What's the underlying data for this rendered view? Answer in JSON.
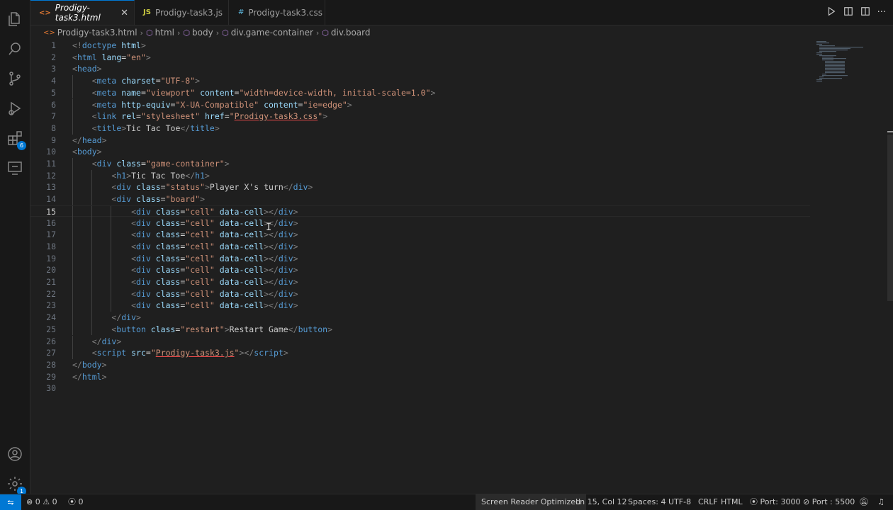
{
  "tabs": [
    {
      "label": "Prodigy-task3.html",
      "icon": "<>",
      "active": true
    },
    {
      "label": "Prodigy-task3.js",
      "icon": "JS",
      "active": false
    },
    {
      "label": "Prodigy-task3.css",
      "icon": "#",
      "active": false
    }
  ],
  "tab_close": "✕",
  "breadcrumb": [
    "Prodigy-task3.html",
    "html",
    "body",
    "div.game-container",
    "div.board"
  ],
  "activity_icons": [
    "files-icon",
    "search-icon",
    "source-control-icon",
    "run-debug-icon",
    "extensions-icon",
    "remote-explorer-icon",
    "account-icon",
    "manage-gear-icon"
  ],
  "badges": {
    "extensions": "6",
    "manage": "1"
  },
  "code_lines": [
    [
      [
        "t",
        "<!"
      ],
      [
        "k",
        "doctype "
      ],
      [
        "a",
        "html"
      ],
      [
        "t",
        ">"
      ]
    ],
    [
      [
        "t",
        "<"
      ],
      [
        "k",
        "html"
      ],
      [
        "a",
        " lang"
      ],
      [
        "p",
        "="
      ],
      [
        "s",
        "\"en\""
      ],
      [
        "t",
        ">"
      ]
    ],
    [
      [
        "t",
        "<"
      ],
      [
        "k",
        "head"
      ],
      [
        "t",
        ">"
      ]
    ],
    [
      [
        "i",
        "    "
      ],
      [
        "t",
        "<"
      ],
      [
        "k",
        "meta"
      ],
      [
        "a",
        " charset"
      ],
      [
        "p",
        "="
      ],
      [
        "s",
        "\"UTF-8\""
      ],
      [
        "t",
        ">"
      ]
    ],
    [
      [
        "i",
        "    "
      ],
      [
        "t",
        "<"
      ],
      [
        "k",
        "meta"
      ],
      [
        "a",
        " name"
      ],
      [
        "p",
        "="
      ],
      [
        "s",
        "\"viewport\""
      ],
      [
        "a",
        " content"
      ],
      [
        "p",
        "="
      ],
      [
        "s",
        "\"width=device-width, initial-scale=1.0\""
      ],
      [
        "t",
        ">"
      ]
    ],
    [
      [
        "i",
        "    "
      ],
      [
        "t",
        "<"
      ],
      [
        "k",
        "meta"
      ],
      [
        "a",
        " http-equiv"
      ],
      [
        "p",
        "="
      ],
      [
        "s",
        "\"X-UA-Compatible\""
      ],
      [
        "a",
        " content"
      ],
      [
        "p",
        "="
      ],
      [
        "s",
        "\"ie=edge\""
      ],
      [
        "t",
        ">"
      ]
    ],
    [
      [
        "i",
        "    "
      ],
      [
        "t",
        "<"
      ],
      [
        "k",
        "link"
      ],
      [
        "a",
        " rel"
      ],
      [
        "p",
        "="
      ],
      [
        "s",
        "\"stylesheet\""
      ],
      [
        "a",
        " href"
      ],
      [
        "p",
        "="
      ],
      [
        "s",
        "\""
      ],
      [
        "u",
        "Prodigy-task3.css"
      ],
      [
        "s",
        "\""
      ],
      [
        "t",
        ">"
      ]
    ],
    [
      [
        "i",
        "    "
      ],
      [
        "t",
        "<"
      ],
      [
        "k",
        "title"
      ],
      [
        "t",
        ">"
      ],
      [
        "p",
        "Tic Tac Toe"
      ],
      [
        "t",
        "</"
      ],
      [
        "k",
        "title"
      ],
      [
        "t",
        ">"
      ]
    ],
    [
      [
        "t",
        "</"
      ],
      [
        "k",
        "head"
      ],
      [
        "t",
        ">"
      ]
    ],
    [
      [
        "t",
        "<"
      ],
      [
        "k",
        "body"
      ],
      [
        "t",
        ">"
      ]
    ],
    [
      [
        "i",
        "    "
      ],
      [
        "t",
        "<"
      ],
      [
        "k",
        "div"
      ],
      [
        "a",
        " class"
      ],
      [
        "p",
        "="
      ],
      [
        "s",
        "\"game-container\""
      ],
      [
        "t",
        ">"
      ]
    ],
    [
      [
        "i",
        "        "
      ],
      [
        "t",
        "<"
      ],
      [
        "k",
        "h1"
      ],
      [
        "t",
        ">"
      ],
      [
        "p",
        "Tic Tac Toe"
      ],
      [
        "t",
        "</"
      ],
      [
        "k",
        "h1"
      ],
      [
        "t",
        ">"
      ]
    ],
    [
      [
        "i",
        "        "
      ],
      [
        "t",
        "<"
      ],
      [
        "k",
        "div"
      ],
      [
        "a",
        " class"
      ],
      [
        "p",
        "="
      ],
      [
        "s",
        "\"status\""
      ],
      [
        "t",
        ">"
      ],
      [
        "p",
        "Player X's turn"
      ],
      [
        "t",
        "</"
      ],
      [
        "k",
        "div"
      ],
      [
        "t",
        ">"
      ]
    ],
    [
      [
        "i",
        "        "
      ],
      [
        "t",
        "<"
      ],
      [
        "k",
        "div"
      ],
      [
        "a",
        " class"
      ],
      [
        "p",
        "="
      ],
      [
        "s",
        "\"board\""
      ],
      [
        "t",
        ">"
      ]
    ],
    [
      [
        "i",
        "            "
      ],
      [
        "t",
        "<"
      ],
      [
        "k",
        "div"
      ],
      [
        "a",
        " class"
      ],
      [
        "p",
        "="
      ],
      [
        "s",
        "\"cell\""
      ],
      [
        "a",
        " data-cell"
      ],
      [
        "t",
        "></"
      ],
      [
        "k",
        "div"
      ],
      [
        "t",
        ">"
      ]
    ],
    [
      [
        "i",
        "            "
      ],
      [
        "t",
        "<"
      ],
      [
        "k",
        "div"
      ],
      [
        "a",
        " class"
      ],
      [
        "p",
        "="
      ],
      [
        "s",
        "\"cell\""
      ],
      [
        "a",
        " data-cell"
      ],
      [
        "t",
        "></"
      ],
      [
        "k",
        "div"
      ],
      [
        "t",
        ">"
      ]
    ],
    [
      [
        "i",
        "            "
      ],
      [
        "t",
        "<"
      ],
      [
        "k",
        "div"
      ],
      [
        "a",
        " class"
      ],
      [
        "p",
        "="
      ],
      [
        "s",
        "\"cell\""
      ],
      [
        "a",
        " data-cell"
      ],
      [
        "t",
        "></"
      ],
      [
        "k",
        "div"
      ],
      [
        "t",
        ">"
      ]
    ],
    [
      [
        "i",
        "            "
      ],
      [
        "t",
        "<"
      ],
      [
        "k",
        "div"
      ],
      [
        "a",
        " class"
      ],
      [
        "p",
        "="
      ],
      [
        "s",
        "\"cell\""
      ],
      [
        "a",
        " data-cell"
      ],
      [
        "t",
        "></"
      ],
      [
        "k",
        "div"
      ],
      [
        "t",
        ">"
      ]
    ],
    [
      [
        "i",
        "            "
      ],
      [
        "t",
        "<"
      ],
      [
        "k",
        "div"
      ],
      [
        "a",
        " class"
      ],
      [
        "p",
        "="
      ],
      [
        "s",
        "\"cell\""
      ],
      [
        "a",
        " data-cell"
      ],
      [
        "t",
        "></"
      ],
      [
        "k",
        "div"
      ],
      [
        "t",
        ">"
      ]
    ],
    [
      [
        "i",
        "            "
      ],
      [
        "t",
        "<"
      ],
      [
        "k",
        "div"
      ],
      [
        "a",
        " class"
      ],
      [
        "p",
        "="
      ],
      [
        "s",
        "\"cell\""
      ],
      [
        "a",
        " data-cell"
      ],
      [
        "t",
        "></"
      ],
      [
        "k",
        "div"
      ],
      [
        "t",
        ">"
      ]
    ],
    [
      [
        "i",
        "            "
      ],
      [
        "t",
        "<"
      ],
      [
        "k",
        "div"
      ],
      [
        "a",
        " class"
      ],
      [
        "p",
        "="
      ],
      [
        "s",
        "\"cell\""
      ],
      [
        "a",
        " data-cell"
      ],
      [
        "t",
        "></"
      ],
      [
        "k",
        "div"
      ],
      [
        "t",
        ">"
      ]
    ],
    [
      [
        "i",
        "            "
      ],
      [
        "t",
        "<"
      ],
      [
        "k",
        "div"
      ],
      [
        "a",
        " class"
      ],
      [
        "p",
        "="
      ],
      [
        "s",
        "\"cell\""
      ],
      [
        "a",
        " data-cell"
      ],
      [
        "t",
        "></"
      ],
      [
        "k",
        "div"
      ],
      [
        "t",
        ">"
      ]
    ],
    [
      [
        "i",
        "            "
      ],
      [
        "t",
        "<"
      ],
      [
        "k",
        "div"
      ],
      [
        "a",
        " class"
      ],
      [
        "p",
        "="
      ],
      [
        "s",
        "\"cell\""
      ],
      [
        "a",
        " data-cell"
      ],
      [
        "t",
        "></"
      ],
      [
        "k",
        "div"
      ],
      [
        "t",
        ">"
      ]
    ],
    [
      [
        "i",
        "        "
      ],
      [
        "t",
        "</"
      ],
      [
        "k",
        "div"
      ],
      [
        "t",
        ">"
      ]
    ],
    [
      [
        "i",
        "        "
      ],
      [
        "t",
        "<"
      ],
      [
        "k",
        "button"
      ],
      [
        "a",
        " class"
      ],
      [
        "p",
        "="
      ],
      [
        "s",
        "\"restart\""
      ],
      [
        "t",
        ">"
      ],
      [
        "p",
        "Restart Game"
      ],
      [
        "t",
        "</"
      ],
      [
        "k",
        "button"
      ],
      [
        "t",
        ">"
      ]
    ],
    [
      [
        "i",
        "    "
      ],
      [
        "t",
        "</"
      ],
      [
        "k",
        "div"
      ],
      [
        "t",
        ">"
      ]
    ],
    [
      [
        "i",
        "    "
      ],
      [
        "t",
        "<"
      ],
      [
        "k",
        "script"
      ],
      [
        "a",
        " src"
      ],
      [
        "p",
        "="
      ],
      [
        "s",
        "\""
      ],
      [
        "u",
        "Prodigy-task3.js"
      ],
      [
        "s",
        "\""
      ],
      [
        "t",
        "></"
      ],
      [
        "k",
        "script"
      ],
      [
        "t",
        ">"
      ]
    ],
    [
      [
        "t",
        "</"
      ],
      [
        "k",
        "body"
      ],
      [
        "t",
        ">"
      ]
    ],
    [
      [
        "t",
        "</"
      ],
      [
        "k",
        "html"
      ],
      [
        "t",
        ">"
      ]
    ],
    []
  ],
  "current_line": 15,
  "status": {
    "errors": "0",
    "warnings": "0",
    "ports_forwarded": "0",
    "screen_reader": "Screen Reader Optimized",
    "cursor_position": "Ln 15, Col 12",
    "indentation": "Spaces: 4",
    "encoding": "UTF-8",
    "eol": "CRLF",
    "language": "HTML",
    "port_server": "Port: 3000",
    "port_live": "Port : 5500"
  },
  "colors": {
    "accent": "#0078d4",
    "tag": "#808080",
    "keyword": "#569cd6",
    "attribute": "#9cdcfe",
    "string": "#ce9178",
    "text": "#cccccc"
  }
}
